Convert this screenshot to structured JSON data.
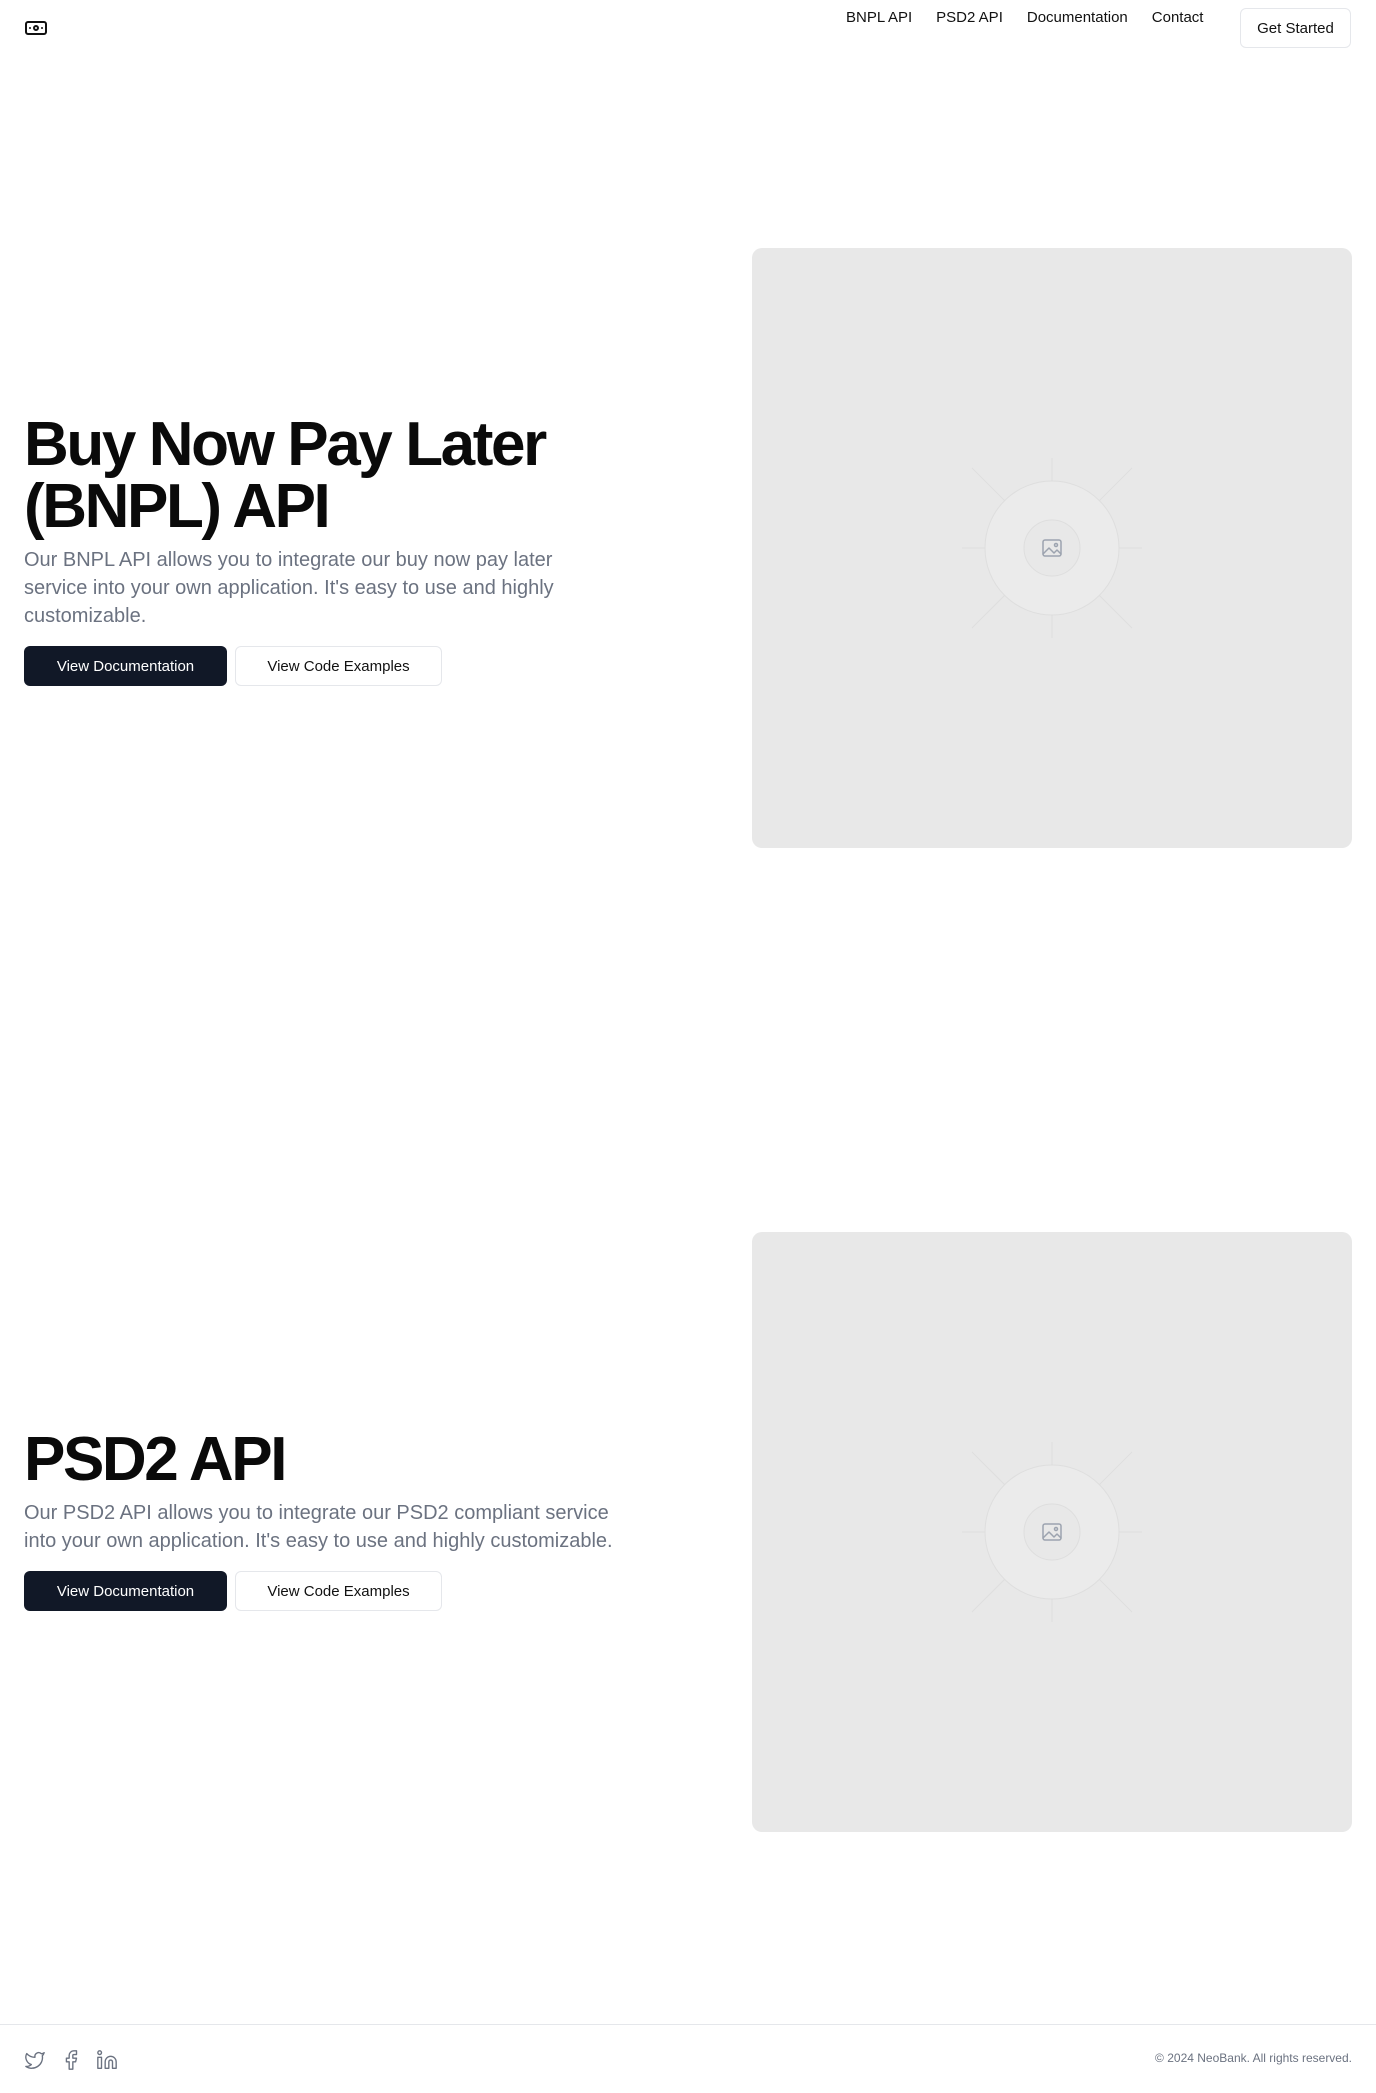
{
  "header": {
    "logo_icon": "banknote-icon",
    "nav": [
      "BNPL API",
      "PSD2 API",
      "Documentation",
      "Contact"
    ],
    "cta_label": "Get Started"
  },
  "sections": [
    {
      "title_line1": "Buy Now Pay Later",
      "title_line2": "(BNPL) API",
      "description": "Our BNPL API allows you to integrate our buy now pay later service into your own application. It's easy to use and highly customizable.",
      "primary_label": "View Documentation",
      "secondary_label": "View Code Examples",
      "image_icon": "image-placeholder-icon"
    },
    {
      "title_line1": "PSD2 API",
      "description": "Our PSD2 API allows you to integrate our PSD2 compliant service into your own application. It's easy to use and highly customizable.",
      "primary_label": "View Documentation",
      "secondary_label": "View Code Examples",
      "image_icon": "image-placeholder-icon"
    }
  ],
  "footer": {
    "social_icons": [
      "twitter-icon",
      "facebook-icon",
      "linkedin-icon"
    ],
    "copyright": "© 2024 NeoBank. All rights reserved."
  },
  "colors": {
    "primary_button": "#111827",
    "placeholder_bg": "#e8e8e8",
    "muted_text": "#6b7280",
    "border": "#e5e7eb"
  }
}
